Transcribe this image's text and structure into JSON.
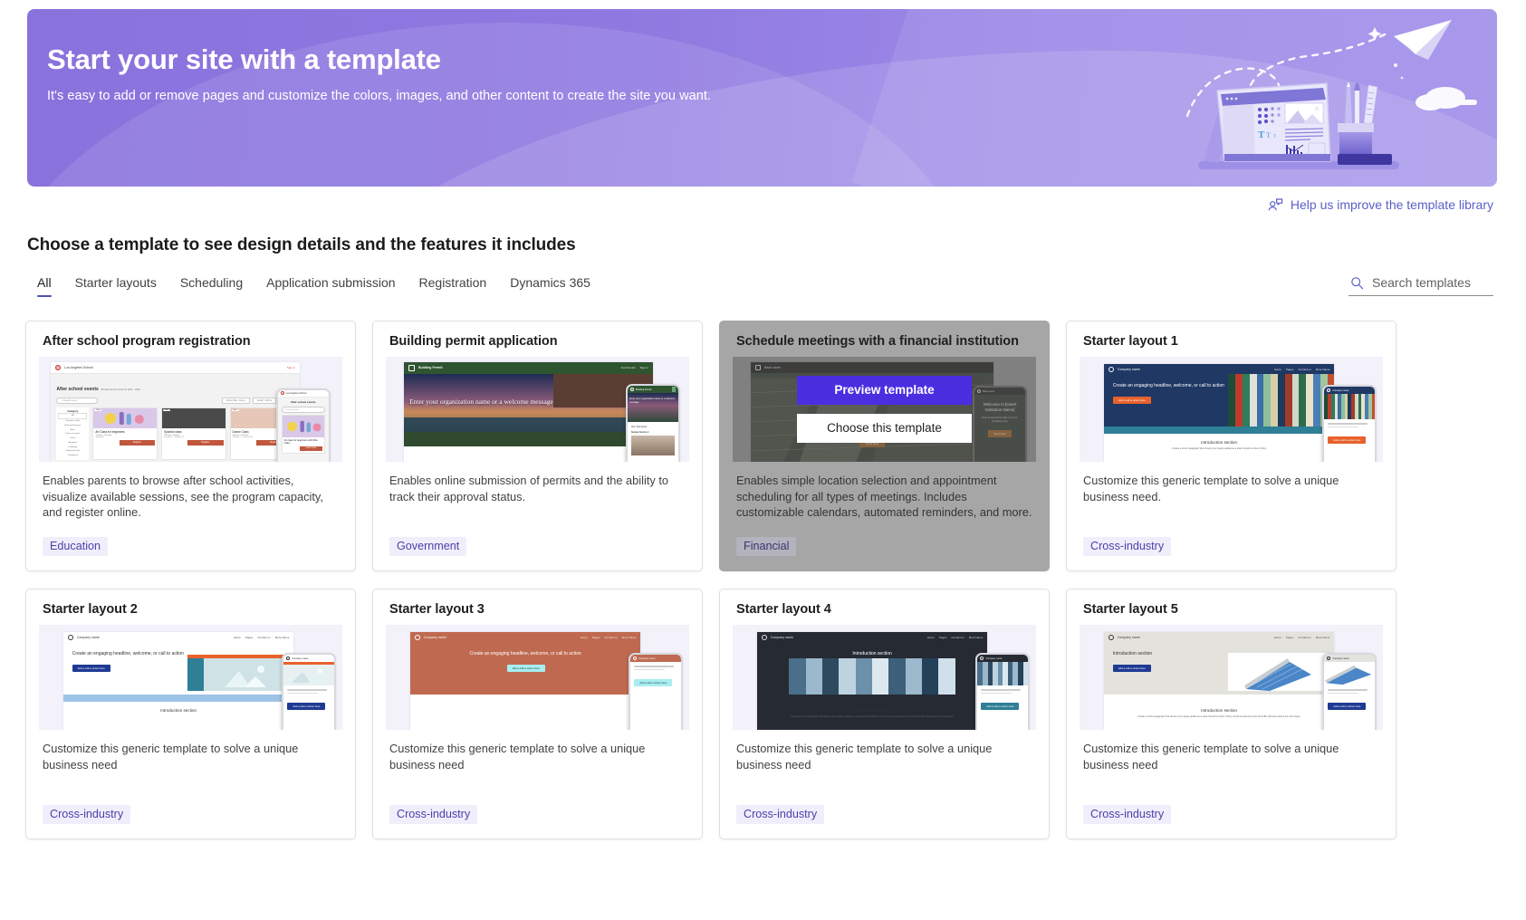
{
  "hero": {
    "title": "Start your site with a template",
    "subtitle": "It's easy to add or remove pages and customize the colors, images, and other content to create the site you want.",
    "art_icon": "workspace-illustration"
  },
  "feedback": {
    "icon": "feedback-person-icon",
    "label": "Help us improve the template library"
  },
  "section": {
    "heading": "Choose a template to see design details and the features it includes"
  },
  "tabs": [
    {
      "label": "All",
      "active": true
    },
    {
      "label": "Starter layouts",
      "active": false
    },
    {
      "label": "Scheduling",
      "active": false
    },
    {
      "label": "Application submission",
      "active": false
    },
    {
      "label": "Registration",
      "active": false
    },
    {
      "label": "Dynamics 365",
      "active": false
    }
  ],
  "search": {
    "icon": "search-icon",
    "placeholder": "Search templates",
    "value": ""
  },
  "overlay": {
    "preview_label": "Preview template",
    "choose_label": "Choose this template"
  },
  "colors": {
    "accent": "#5b5fc7",
    "tab_underline": "#4f52b2",
    "preview_button": "#4b2ee0",
    "tag_background": "#f0eefb",
    "tag_text": "#4a41a8",
    "hover_card": "#a6a6a6",
    "hero_gradient_start": "#8a72dd",
    "hero_gradient_end": "#a18fe9"
  },
  "cards": [
    {
      "title": "After school program registration",
      "description": "Enables parents to browse after school activities, visualize available sessions, see the program capacity, and register online.",
      "tag": "Education",
      "hovered": false,
      "preview": {
        "brand": "Los Angeles School",
        "signin": "Sign in",
        "headline": "After school events",
        "subhead": "Browse all the events for 2021 - 2022",
        "search": "Search event",
        "filters": [
          "Winter (Dec - Feb)",
          "Jan/22 - 01/23",
          "Type"
        ],
        "sidebar_title": "Category",
        "sidebar_items": [
          "All",
          "Summer school",
          "Art & performance",
          "Music",
          "Fitness & sports",
          "Dance",
          "Academic",
          "Language",
          "Homework club",
          "Conference"
        ],
        "classes": [
          {
            "name": "Art Class for beginners",
            "time": "7:00 pm - 8:00 pm",
            "date": "January 3",
            "cta": "Register"
          },
          {
            "name": "Spanish class",
            "time": "2:00 pm - 4:00 pm",
            "date": "January 7 - January 15",
            "cta": "Register"
          },
          {
            "name": "Dance Class",
            "time": "4:00 pm - 6:00 pm",
            "date": "January 7 - January 15",
            "cta": "Register"
          }
        ],
        "phone_headline": "After school events",
        "phone_class": "Art class for beginners with Miss Cathy",
        "phone_cta": "Learn more"
      }
    },
    {
      "title": "Building permit application",
      "description": "Enables online submission of permits and the ability to track their approval status.",
      "tag": "Government",
      "hovered": false,
      "preview": {
        "brand": "Building Permit",
        "nav": [
          "Our Permits",
          "Sign in"
        ],
        "headline": "Enter your organization name or a welcome message",
        "services_title": "Our Services",
        "service_item": "Sample Service 1"
      }
    },
    {
      "title": "Schedule meetings with a financial institution",
      "description": "Enables simple location selection and appointment scheduling for all types of meetings. Includes customizable calendars, automated reminders, and more.",
      "tag": "Financial",
      "hovered": true,
      "preview": {
        "brand": "Bank name",
        "cta": "Book Now",
        "phone_headline": "Welcome to [Insert Institution Name]",
        "phone_sub": "Book an appointment with one of our specialists today",
        "phone_cta": "Book Now"
      }
    },
    {
      "title": "Starter layout 1",
      "description": "Customize this generic template to solve a unique business need.",
      "tag": "Cross-industry",
      "hovered": false,
      "preview": {
        "brand": "Company name",
        "nav": [
          "Home",
          "Pages",
          "Contact us",
          "More Name"
        ],
        "headline": "Create an engaging headline, welcome, or call to action",
        "cta": "Add a call to action here",
        "intro_title": "Introduction section",
        "intro_body": "Create a short paragraph that shows your target audience a clear benefit to them if they"
      }
    },
    {
      "title": "Starter layout 2",
      "description": "Customize this generic template to solve a unique business need",
      "tag": "Cross-industry",
      "hovered": false,
      "preview": {
        "brand": "Company name",
        "nav": [
          "Home",
          "Pages",
          "Contact us",
          "More Name"
        ],
        "headline": "Create an engaging headline, welcome, or call to action",
        "cta": "Add a call to action here",
        "intro_title": "Introduction section"
      }
    },
    {
      "title": "Starter layout 3",
      "description": "Customize this generic template to solve a unique business need",
      "tag": "Cross-industry",
      "hovered": false,
      "preview": {
        "brand": "Company name",
        "nav": [
          "Home",
          "Pages",
          "Contact us",
          "More Name"
        ],
        "headline": "Create an engaging headline, welcome, or call to action",
        "cta": "Add a call to action here"
      }
    },
    {
      "title": "Starter layout 4",
      "description": "Customize this generic template to solve a unique business need",
      "tag": "Cross-industry",
      "hovered": false,
      "preview": {
        "brand": "Company name",
        "nav": [
          "Home",
          "Pages",
          "Contact us",
          "More Name"
        ],
        "intro_title": "Introduction section",
        "intro_body": "Create a short paragraph that shows your target audience a clear benefit to them if they continue past this point and offer direction about the next steps.",
        "cta": "Add a call to action here"
      }
    },
    {
      "title": "Starter layout 5",
      "description": "Customize this generic template to solve a unique business need",
      "tag": "Cross-industry",
      "hovered": false,
      "preview": {
        "brand": "Company name",
        "nav": [
          "Home",
          "Pages",
          "Contact us",
          "More Name"
        ],
        "intro_title": "Introduction section",
        "intro_body": "Create a short paragraph that shows your target audience a clear benefit to them if they continue past this point and offer direction about the next steps.",
        "cta_primary": "Add a call to action here",
        "cta_secondary": "Add a call to action here"
      }
    }
  ]
}
